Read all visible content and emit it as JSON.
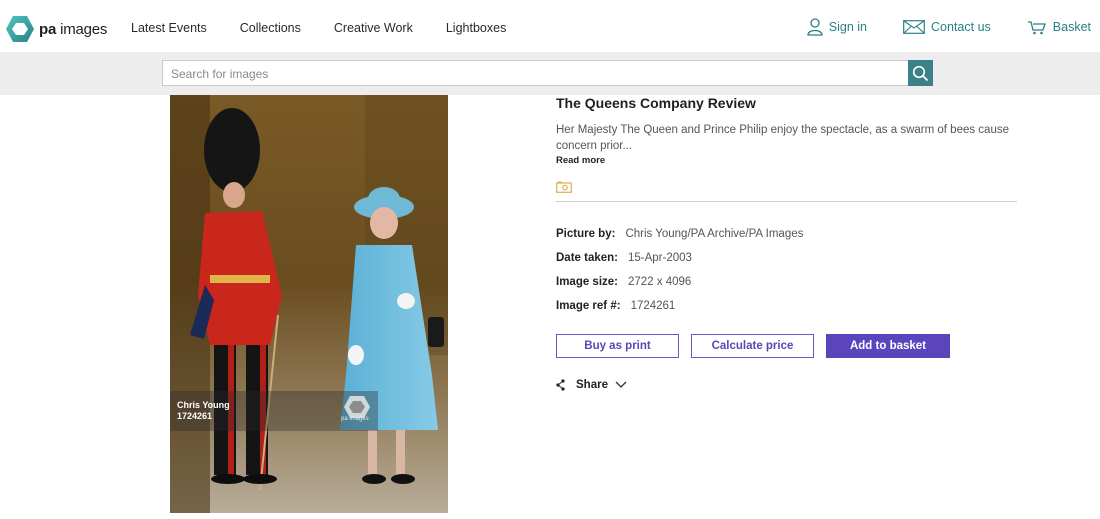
{
  "brand": {
    "logo_bold": "pa",
    "logo_light": "images"
  },
  "nav": {
    "links": [
      "Latest Events",
      "Collections",
      "Creative Work",
      "Lightboxes"
    ],
    "sign_in": "Sign in",
    "contact": "Contact us",
    "basket": "Basket"
  },
  "search": {
    "placeholder": "Search for images"
  },
  "photo": {
    "credit_name": "Chris Young",
    "credit_ref": "1724261",
    "watermark": "pa images"
  },
  "image": {
    "title": "The Queens Company Review",
    "caption": "Her Majesty The Queen and Prince Philip enjoy the spectacle, as a swarm of bees cause concern prior...",
    "read_more": "Read more",
    "meta": [
      {
        "label": "Picture by:",
        "value": "Chris Young/PA Archive/PA Images"
      },
      {
        "label": "Date taken:",
        "value": "15-Apr-2003"
      },
      {
        "label": "Image size:",
        "value": "2722 x 4096"
      },
      {
        "label": "Image ref #:",
        "value": "1724261"
      }
    ]
  },
  "actions": {
    "buy_print": "Buy as print",
    "calc_price": "Calculate price",
    "add_basket": "Add to basket",
    "share": "Share"
  },
  "colors": {
    "accent_teal": "#2a7f8a",
    "search_btn": "#3c8189",
    "purple": "#5b45bf"
  }
}
